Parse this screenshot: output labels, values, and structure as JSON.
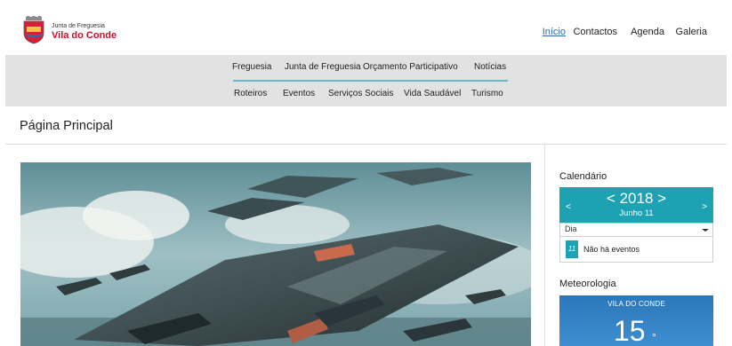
{
  "brand": {
    "small": "Junta de Freguesia",
    "big": "Vila do Conde"
  },
  "topnav": [
    {
      "label": "Início",
      "active": true
    },
    {
      "label": "Contactos",
      "active": false
    },
    {
      "label": "Agenda",
      "active": false
    },
    {
      "label": "Galeria",
      "active": false
    }
  ],
  "menu_row1": [
    "Freguesia",
    "Junta de Freguesia",
    "Orçamento Participativo",
    "Notícias"
  ],
  "menu_row2": [
    "Roteiros",
    "Eventos",
    "Serviços Sociais",
    "Vida Saudável",
    "Turismo"
  ],
  "page": {
    "title": "Página Principal"
  },
  "hero": {
    "icon": "sci-fi-aircraft-illustration"
  },
  "calendar": {
    "heading": "Calendário",
    "prev": "<",
    "next": ">",
    "year_display": "< 2018 >",
    "month_display": "Junho 11",
    "view_select": "Dia",
    "event_day": "11",
    "event_text": "Não há eventos"
  },
  "weather": {
    "heading": "Meteorologia",
    "location": "VILA DO CONDE",
    "temperature": "15",
    "unit": "°"
  },
  "colors": {
    "accent": "#1da2b3",
    "link_active": "#2a6db5",
    "brand_red": "#c8102e",
    "band": "#e2e2e2"
  }
}
